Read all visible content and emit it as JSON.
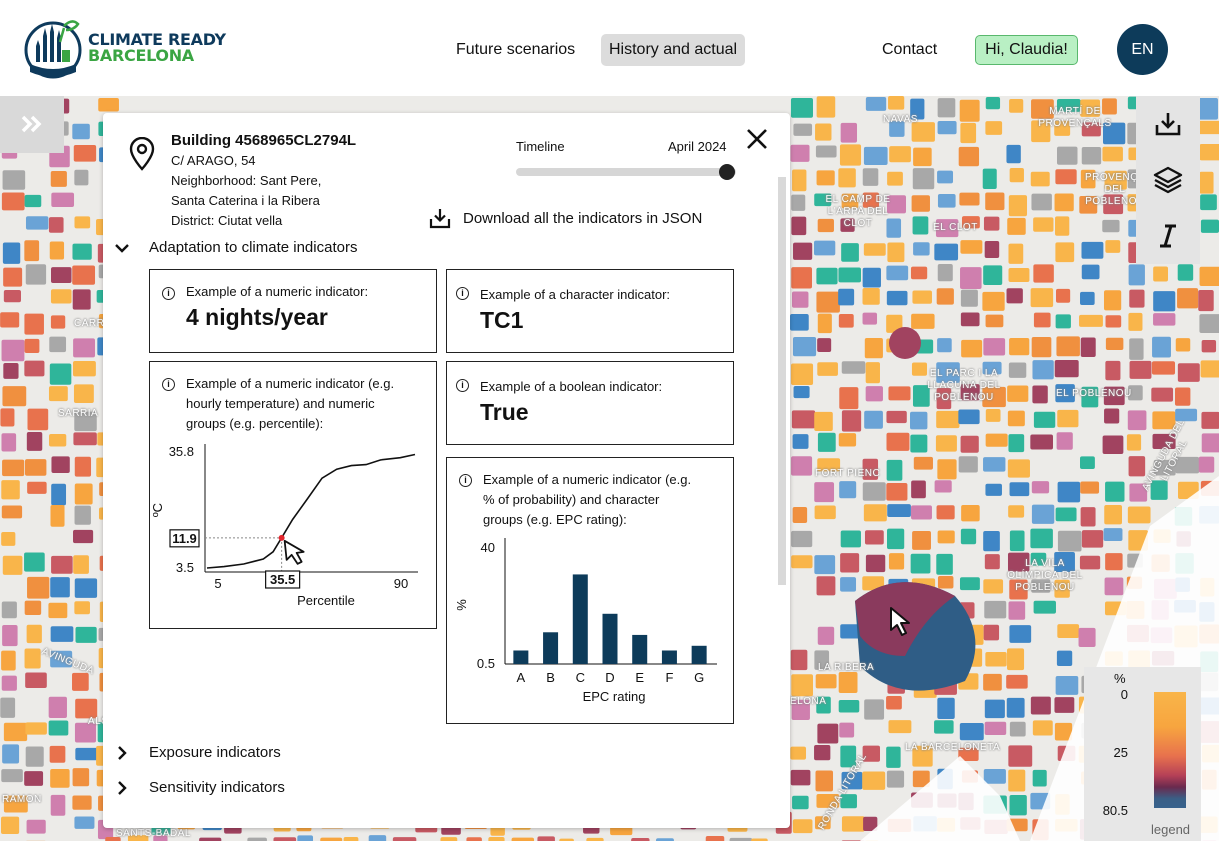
{
  "header": {
    "logo_line1": "CLIMATE READY",
    "logo_line2": "BARCELONA",
    "nav": [
      "Future scenarios",
      "History and actual",
      "Contact"
    ],
    "active_nav": "History and actual",
    "user_greeting": "Hi, Claudia!",
    "language": "EN"
  },
  "map": {
    "labels": [
      "NAVAS",
      "MARTÍ DE PROVENÇALS",
      "PROVENÇALS DEL POBLENOU",
      "EL CAMP DE L'ARPA DEL CLOT",
      "EL CLOT",
      "CARRER",
      "SARRIA",
      "EL PARC I LA LLACUNA DEL POBLENOU",
      "EL POBLENOU",
      "FORT PIENC",
      "LA VILA OLÍMPICA DEL POBLENOU",
      "LA RIBERA",
      "AVINGUDA DEL LITORAL",
      "LA BARCELONETA",
      "RONDA LITORAL",
      "AVINGUDA",
      "SANTS-BADAL",
      "RAMON",
      "ELONA",
      "ALS"
    ],
    "icons": [
      "expand-icon",
      "download-icon",
      "layers-icon",
      "italic-icon",
      "cursor-icon"
    ]
  },
  "legend": {
    "unit": "%",
    "ticks": [
      "0",
      "25",
      "80.5"
    ],
    "caption": "legend",
    "colors": [
      "#f9b54a",
      "#e8724d",
      "#b54057",
      "#6a2a4e",
      "#38628d"
    ]
  },
  "panel": {
    "building_title": "Building 4568965CL2794L",
    "address": "C/ ARAGO, 54",
    "neighborhood_line1": "Neighborhood:  Sant Pere,",
    "neighborhood_line2": "Santa Caterina i la Ribera",
    "district": "District: Ciutat vella",
    "timeline_label": "Timeline",
    "timeline_date": "April 2024",
    "timeline_value": 1.0,
    "download_label": "Download all the indicators in JSON",
    "sections": [
      {
        "label": "Adaptation to climate indicators",
        "expanded": true
      },
      {
        "label": "Exposure indicators",
        "expanded": false
      },
      {
        "label": "Sensitivity indicators",
        "expanded": false
      }
    ],
    "cards": {
      "numeric": {
        "label": "Example of a numeric indicator:",
        "value": "4 nights/year"
      },
      "character": {
        "label": "Example of a character indicator:",
        "value": "TC1"
      },
      "boolean": {
        "label": "Example of a boolean indicator:",
        "value": "True"
      },
      "line_chart": {
        "label_lines": [
          "Example of a numeric indicator (e.g.",
          "hourly temperature) and numeric",
          "groups (e.g. percentile):"
        ]
      },
      "bar_chart": {
        "label_lines": [
          "Example of a numeric indicator (e.g.",
          "% of probability) and character",
          "groups (e.g. EPC rating):"
        ]
      }
    }
  },
  "chart_data": [
    {
      "type": "line",
      "xlabel": "Percentile",
      "ylabel": "ºC",
      "x_ticks": [
        "5",
        "90"
      ],
      "y_ticks": [
        "35.8",
        "3.5"
      ],
      "xlim": [
        5,
        90
      ],
      "ylim": [
        3.5,
        35.8
      ],
      "highlight": {
        "x": 35.5,
        "y": 11.9,
        "x_label": "35.5",
        "y_label": "11.9"
      },
      "x": [
        5,
        12,
        20,
        28,
        32,
        35.5,
        40,
        46,
        52,
        58,
        64,
        70,
        76,
        84,
        90
      ],
      "y": [
        3.5,
        3.9,
        4.6,
        6.0,
        8.0,
        11.9,
        17.0,
        22.7,
        28.5,
        31.0,
        32.0,
        32.3,
        33.6,
        34.2,
        35.1
      ]
    },
    {
      "type": "bar",
      "xlabel": "EPC rating",
      "ylabel": "%",
      "y_ticks": [
        "40",
        "0.5"
      ],
      "ylim": [
        0.5,
        40
      ],
      "categories": [
        "A",
        "B",
        "C",
        "D",
        "E",
        "F",
        "G"
      ],
      "values": [
        5.1,
        11.3,
        31.0,
        17.6,
        10.4,
        5.1,
        6.7
      ],
      "color": "#0d3b5a"
    }
  ]
}
